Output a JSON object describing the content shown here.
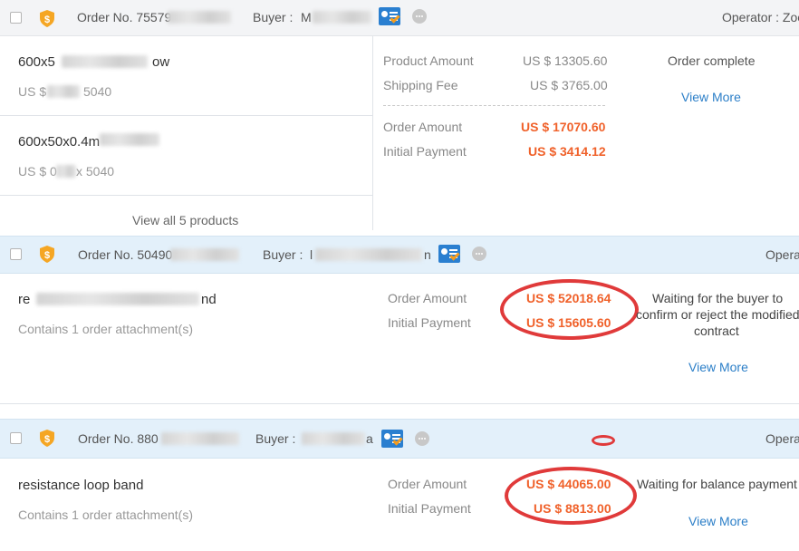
{
  "orders": [
    {
      "order_no": "Order No. 75579",
      "buyer_label": "Buyer :",
      "buyer_value": "M",
      "operator": "Operator : Zoe",
      "products": [
        {
          "name_start": "600x5",
          "name_end": "ow",
          "price_start": "US $",
          "price_end": "5040"
        },
        {
          "name_start": "600x50x0.4m",
          "name_end": "",
          "price_start": "US $ 0",
          "price_end": "x 5040"
        }
      ],
      "view_all": "View all 5 products",
      "product_amount_label": "Product Amount",
      "product_amount": "US $ 13305.60",
      "shipping_fee_label": "Shipping Fee",
      "shipping_fee": "US $ 3765.00",
      "order_amount_label": "Order Amount",
      "order_amount": "US $ 17070.60",
      "initial_payment_label": "Initial Payment",
      "initial_payment": "US $ 3414.12",
      "status": "Order complete",
      "view_more": "View More"
    },
    {
      "order_no": "Order No. 50490",
      "buyer_label": "Buyer :",
      "buyer_value": "l",
      "buyer_value_end": "n",
      "operator": "Opera",
      "product_name_start": "re",
      "product_name_end": "nd",
      "attachment": "Contains 1 order attachment(s)",
      "order_amount_label": "Order Amount",
      "order_amount": "US $ 52018.64",
      "initial_payment_label": "Initial Payment",
      "initial_payment": "US $ 15605.60",
      "status_line1": "Waiting for the buyer to",
      "status_line2": "confirm or reject the modified",
      "status_line3": "contract",
      "view_more": "View More"
    },
    {
      "order_no": "Order No. 880",
      "buyer_label": "Buyer :",
      "buyer_value": "a",
      "operator": "Opera",
      "product_name": "resistance loop band",
      "attachment": "Contains 1 order attachment(s)",
      "order_amount_label": "Order Amount",
      "order_amount": "US $ 44065.00",
      "initial_payment_label": "Initial Payment",
      "initial_payment": "US $ 8813.00",
      "status": "Waiting for balance payment",
      "view_more": "View More"
    }
  ],
  "colors": {
    "accent": "#f0612a",
    "link": "#2c7fc8",
    "annotation": "#e03a3a",
    "shield": "#f5a623"
  },
  "icons": [
    "checkbox",
    "shield-icon",
    "verified-card-icon",
    "chat-icon"
  ]
}
